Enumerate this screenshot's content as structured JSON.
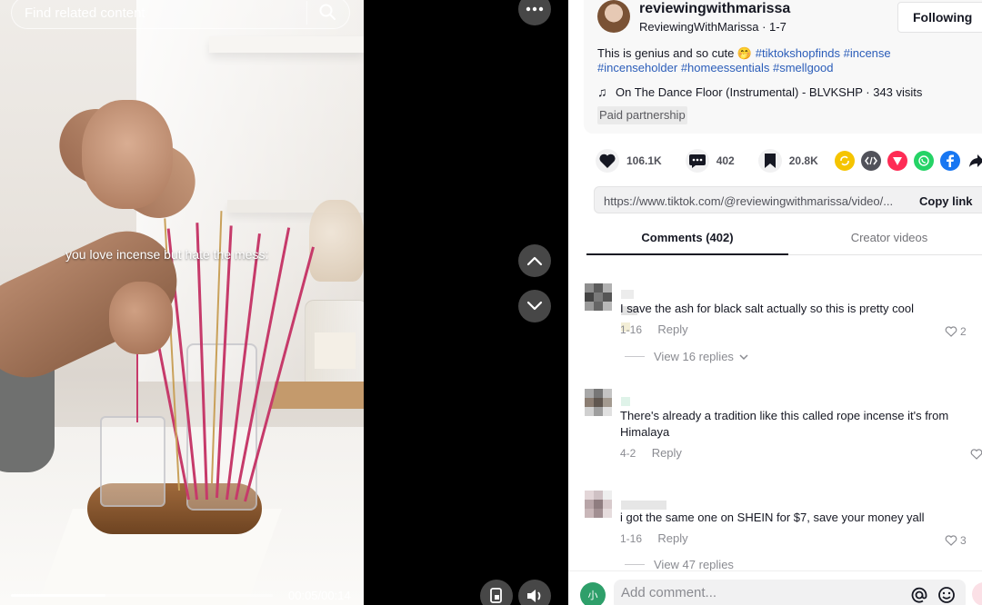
{
  "video": {
    "search_placeholder": "Find related content",
    "caption": "you love incense but hate the mess:",
    "progress": 0.36,
    "time": "00:05/00:14"
  },
  "post": {
    "username": "reviewingwithmarissa",
    "handle_line": "ReviewingWithMarissa · 1-7",
    "follow_label": "Following",
    "desc_text": "This is genius and so cute 🤭",
    "hashtags": [
      "#tiktokshopfinds",
      "#incense",
      "#incenseholder",
      "#homeessentials",
      "#smellgood"
    ],
    "music": "On The Dance Floor (Instrumental) - BLVKSHP · 343 visits",
    "paid_label": "Paid partnership"
  },
  "stats": {
    "likes": "106.1K",
    "comments": "402",
    "saves": "20.8K"
  },
  "share_icons": [
    {
      "name": "repost-icon",
      "color": "#f5c400"
    },
    {
      "name": "embed-icon",
      "color": "#51525a"
    },
    {
      "name": "send-icon",
      "color": "#fe2c55"
    },
    {
      "name": "whatsapp-icon",
      "color": "#25d366"
    },
    {
      "name": "facebook-icon",
      "color": "#1877f2"
    }
  ],
  "link": {
    "url": "https://www.tiktok.com/@reviewingwithmarissa/video/...",
    "copy_label": "Copy link"
  },
  "tabs": {
    "comments": "Comments (402)",
    "creator": "Creator videos"
  },
  "comments": [
    {
      "text": "I save the ash for black salt actually so this is pretty cool",
      "date": "1-16",
      "reply": "Reply",
      "likes": "2",
      "view_replies": "View 16 replies"
    },
    {
      "text": "There's already a tradition like this called rope incense it's from Himalaya",
      "date": "4-2",
      "reply": "Reply",
      "likes": ""
    },
    {
      "text": "i got the same one on SHEIN for $7, save your money yall",
      "date": "1-16",
      "reply": "Reply",
      "likes": "3",
      "view_replies": "View 47 replies"
    }
  ],
  "compose": {
    "placeholder": "Add comment...",
    "avatar_letter": "小"
  }
}
